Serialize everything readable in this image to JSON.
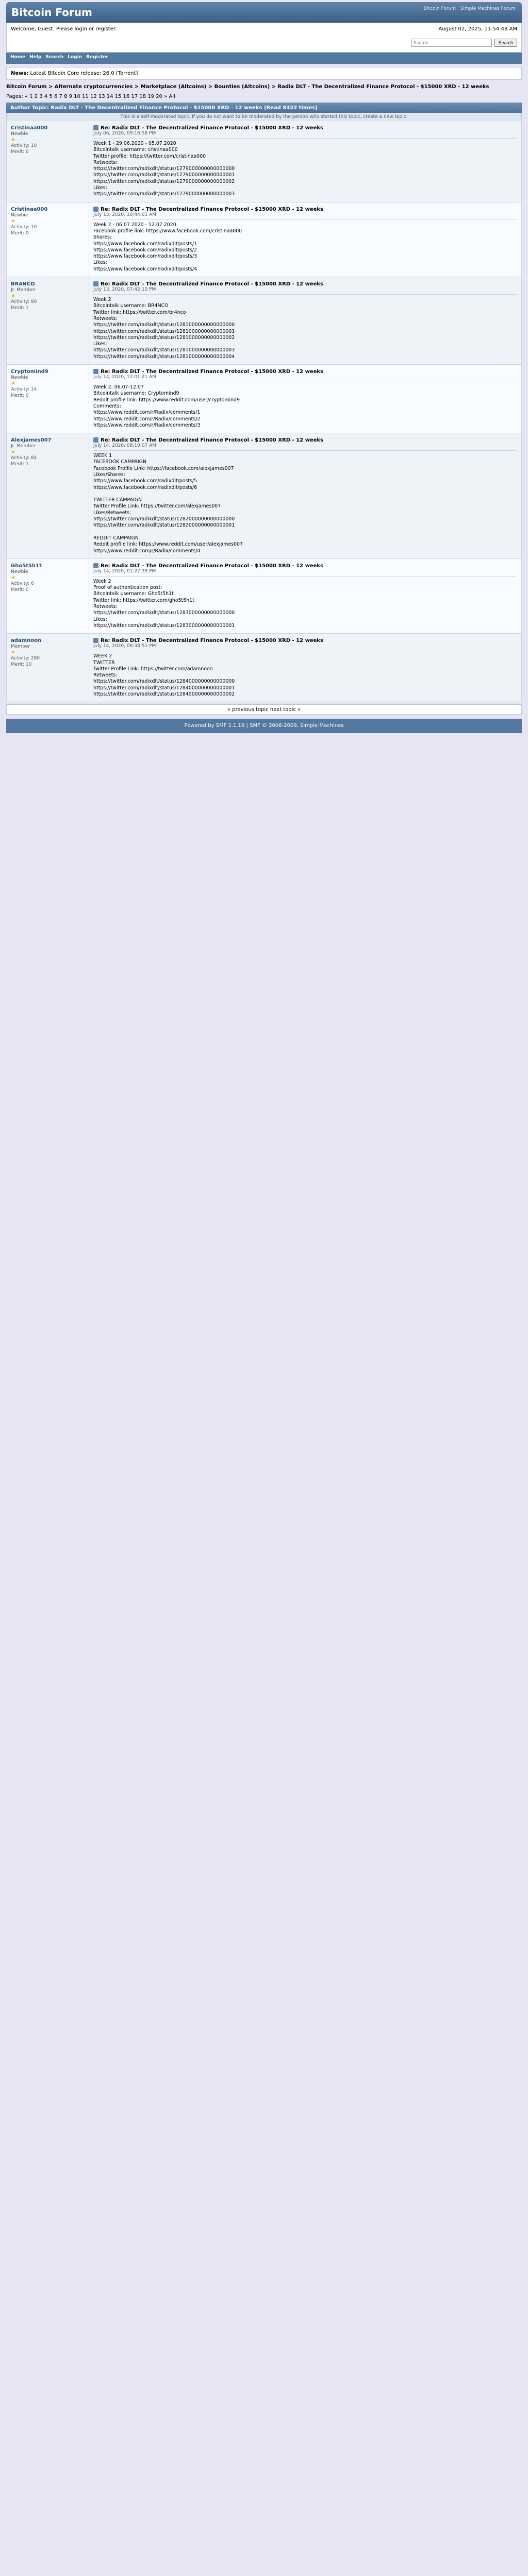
{
  "header": {
    "logo": "Bitcoin Forum",
    "logo_right": "Bitcoin Forum · Simple Machines Forum",
    "greeting": "Welcome, Guest. Please login or register.",
    "date": "August 02, 2025, 11:54:48 AM",
    "news_label": "News:",
    "news": "Latest Bitcoin Core release: 26.0 [Torrent]",
    "search_placeholder": "Search",
    "search_button": "Search"
  },
  "nav": [
    "Home",
    "Help",
    "Search",
    "Login",
    "Register"
  ],
  "breadcrumb": "Bitcoin Forum > Alternate cryptocurrencies > Marketplace (Altcoins) > Bounties (Altcoins) > Radix DLT - The Decentralized Finance Protocol - $15000 XRD - 12 weeks",
  "pages_top": "Pages: « 1 2 3 4 5 6 7 8 9 10 11 12 13 14 15 16 17 18 19 20 » All",
  "thread_title": "Author   Topic: Radix DLT - The Decentralized Finance Protocol - $15000 XRD - 12 weeks (Read 8322 times)",
  "subhead": "This is a self-moderated topic. If you do not want to be moderated by the person who started this topic, create a new topic.",
  "pager_mid": "« previous topic next topic »",
  "footer": "Powered by SMF 1.1.19 | SMF © 2006-2009, Simple Machines",
  "posts": [
    {
      "author": "Cristinaa000",
      "rank": "Newbie",
      "activity": "Activity: 10",
      "merit": "Merit: 0",
      "title": "Re: Radix DLT - The Decentralized Finance Protocol - $15000 XRD - 12 weeks",
      "date": "July 06, 2020, 09:16:58 PM",
      "body": "Week 1 - 29.06.2020 - 05.07.2020\nBitcointalk username: cristinaa000\nTwitter profile: https://twitter.com/cristinaa000\nRetweets:\nhttps://twitter.com/radixdlt/status/1279000000000000000\nhttps://twitter.com/radixdlt/status/1279000000000000001\nhttps://twitter.com/radixdlt/status/1279000000000000002\nLikes:\nhttps://twitter.com/radixdlt/status/1279000000000000003"
    },
    {
      "author": "Cristinaa000",
      "rank": "Newbie",
      "activity": "Activity: 10",
      "merit": "Merit: 0",
      "title": "Re: Radix DLT - The Decentralized Finance Protocol - $15000 XRD - 12 weeks",
      "date": "July 13, 2020, 10:44:01 AM",
      "body": "Week 2 - 06.07.2020 - 12.07.2020\nFacebook profile link: https://www.facebook.com/cristinaa000\nShares:\nhttps://www.facebook.com/radixdlt/posts/1\nhttps://www.facebook.com/radixdlt/posts/2\nhttps://www.facebook.com/radixdlt/posts/3\nLikes:\nhttps://www.facebook.com/radixdlt/posts/4"
    },
    {
      "author": "BR4NCO",
      "rank": "Jr. Member",
      "activity": "Activity: 90",
      "merit": "Merit: 1",
      "title": "Re: Radix DLT - The Decentralized Finance Protocol - $15000 XRD - 12 weeks",
      "date": "July 13, 2020, 07:42:10 PM",
      "body": "Week 2\nBitcointalk username: BR4NCO\nTwitter link: https://twitter.com/br4nco\nRetweets:\nhttps://twitter.com/radixdlt/status/1281000000000000000\nhttps://twitter.com/radixdlt/status/1281000000000000001\nhttps://twitter.com/radixdlt/status/1281000000000000002\nLikes:\nhttps://twitter.com/radixdlt/status/1281000000000000003\nhttps://twitter.com/radixdlt/status/1281000000000000004"
    },
    {
      "author": "Cryptomind9",
      "rank": "Newbie",
      "activity": "Activity: 14",
      "merit": "Merit: 0",
      "title": "Re: Radix DLT - The Decentralized Finance Protocol - $15000 XRD - 12 weeks",
      "date": "July 14, 2020, 12:01:21 AM",
      "body": "Week 2: 06.07-12.07\nBitcointalk username: Cryptomind9\nReddit profile link: https://www.reddit.com/user/cryptomind9\nComments:\nhttps://www.reddit.com/r/Radix/comments/1\nhttps://www.reddit.com/r/Radix/comments/2\nhttps://www.reddit.com/r/Radix/comments/3"
    },
    {
      "author": "Alexjames007",
      "rank": "Jr. Member",
      "activity": "Activity: 84",
      "merit": "Merit: 1",
      "title": "Re: Radix DLT - The Decentralized Finance Protocol - $15000 XRD - 12 weeks",
      "date": "July 14, 2020, 08:10:07 AM",
      "body": "WEEK 1\nFACEBOOK CAMPAIGN\nFacebook Profile Link: https://facebook.com/alexjames007\nLikes/Shares:\nhttps://www.facebook.com/radixdlt/posts/5\nhttps://www.facebook.com/radixdlt/posts/6\n\nTWITTER CAMPAIGN\nTwitter Profile Link: https://twitter.com/alexjames007\nLikes/Retweets:\nhttps://twitter.com/radixdlt/status/1282000000000000000\nhttps://twitter.com/radixdlt/status/1282000000000000001\n\nREDDIT CAMPAIGN\nReddit profile link: https://www.reddit.com/user/alexjames007\nhttps://www.reddit.com/r/Radix/comments/4"
    },
    {
      "author": "Gho5t5h1t",
      "rank": "Newbie",
      "activity": "Activity: 6",
      "merit": "Merit: 0",
      "title": "Re: Radix DLT - The Decentralized Finance Protocol - $15000 XRD - 12 weeks",
      "date": "July 14, 2020, 01:27:39 PM",
      "body": "Week 2\nProof of authentication post:\nBitcointalk username: Gho5t5h1t\nTwitter link: https://twitter.com/gho5t5h1t\nRetweets:\nhttps://twitter.com/radixdlt/status/1283000000000000000\nLikes:\nhttps://twitter.com/radixdlt/status/1283000000000000001"
    },
    {
      "author": "adamnoon",
      "rank": "Member",
      "activity": "Activity: 280",
      "merit": "Merit: 10",
      "title": "Re: Radix DLT - The Decentralized Finance Protocol - $15000 XRD - 12 weeks",
      "date": "July 14, 2020, 06:38:51 PM",
      "body": "WEEK 2\nTWITTER\nTwitter Profile Link: https://twitter.com/adamnoon\nRetweets:\nhttps://twitter.com/radixdlt/status/1284000000000000000\nhttps://twitter.com/radixdlt/status/1284000000000000001\nhttps://twitter.com/radixdlt/status/1284000000000000002"
    }
  ]
}
